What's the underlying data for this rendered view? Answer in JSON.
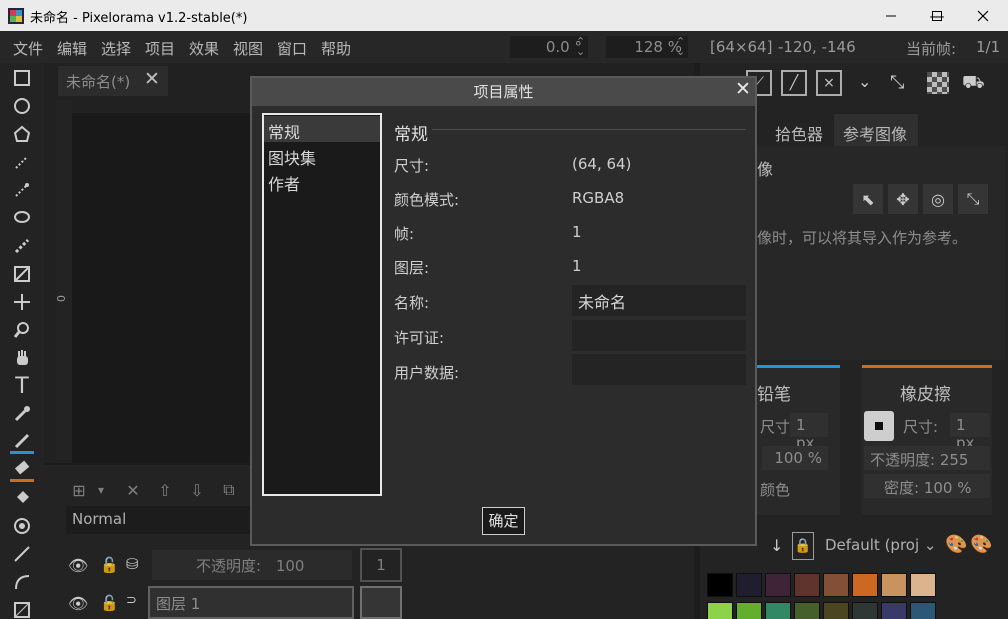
{
  "window": {
    "title": "未命名 - Pixelorama v1.2-stable(*)",
    "minimize_label": "—",
    "maximize_label": "☐",
    "close_label": "✕"
  },
  "menu": {
    "items": [
      "文件",
      "编辑",
      "选择",
      "项目",
      "效果",
      "视图",
      "窗口",
      "帮助"
    ],
    "rotation": "0.0 °",
    "zoom": "128 %",
    "canvas_size": "[64×64]",
    "cursor": "-120, -146",
    "current_frame_label": "当前帧:",
    "current_frame": "1/1"
  },
  "canvas": {
    "tab_title": "未命名(*)",
    "ruler_zero": "0"
  },
  "timeline": {
    "blend_mode": "Normal",
    "opacity_label": "不透明度:",
    "opacity_value": "100",
    "frame_number": "1",
    "layer_name": "图层 1"
  },
  "right": {
    "tab_color_picker": "拾色器",
    "tab_reference_image": "参考图像",
    "ref_heading": "像",
    "ref_hint": "像时，可以将其导入作为参考。",
    "left_tool_title": "铅笔",
    "left_size_label": "尺寸:",
    "left_size_value": "1 px",
    "left_opacity_value": "100 %",
    "left_color_label": "颜色",
    "right_tool_title": "橡皮擦",
    "right_size_label": "尺寸:",
    "right_size_value": "1 px",
    "right_opacity_label": "不透明度:",
    "right_opacity_value": "255",
    "right_density_label": "密度:",
    "right_density_value": "100 %",
    "palette_name": "Default (proj",
    "left_color": "#29a2e6",
    "right_color": "#e07820",
    "palette_row1": [
      "#000000",
      "#222034",
      "#45283c",
      "#663931",
      "#8f563b",
      "#df7126",
      "#d9a066",
      "#eec39a"
    ],
    "palette_row2": [
      "#99e550",
      "#6abe30",
      "#37946e",
      "#4b692f",
      "#524b24",
      "#323c39",
      "#3f3f74",
      "#306082"
    ]
  },
  "dialog": {
    "title": "项目属性",
    "nav": [
      "常规",
      "图块集",
      "作者"
    ],
    "section_title": "常规",
    "size_label": "尺寸:",
    "size_value": "(64, 64)",
    "color_mode_label": "颜色模式:",
    "color_mode_value": "RGBA8",
    "frames_label": "帧:",
    "frames_value": "1",
    "layers_label": "图层:",
    "layers_value": "1",
    "name_label": "名称:",
    "name_value": "未命名",
    "license_label": "许可证:",
    "license_value": "",
    "user_data_label": "用户数据:",
    "user_data_value": "",
    "ok_label": "确定"
  }
}
